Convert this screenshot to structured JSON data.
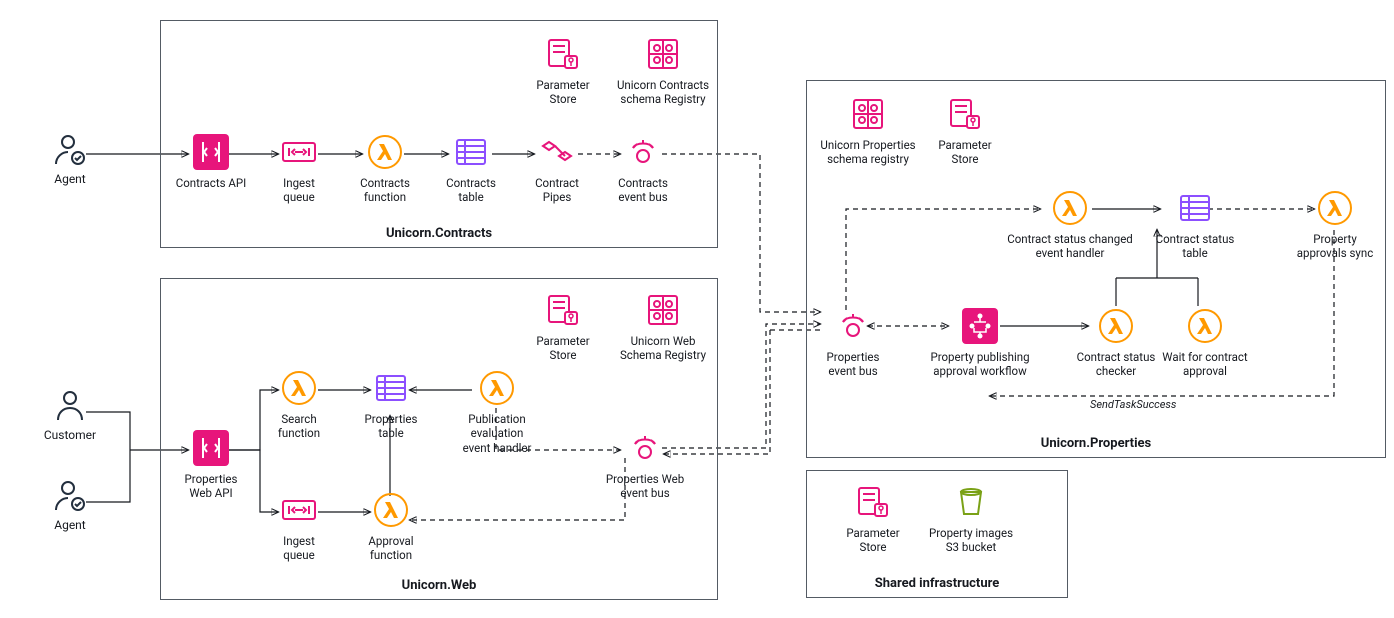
{
  "actors": {
    "agent1": "Agent",
    "customer": "Customer",
    "agent2": "Agent"
  },
  "contracts_box": {
    "title": "Unicorn.Contracts",
    "nodes": {
      "api": "Contracts API",
      "ingest": "Ingest\nqueue",
      "func": "Contracts\nfunction",
      "table": "Contracts\ntable",
      "pipes": "Contract\nPipes",
      "bus": "Contracts\nevent bus",
      "param": "Parameter\nStore",
      "schema": "Unicorn Contracts\nschema Registry"
    }
  },
  "web_box": {
    "title": "Unicorn.Web",
    "nodes": {
      "api": "Properties\nWeb API",
      "search": "Search\nfunction",
      "ingest": "Ingest\nqueue",
      "table": "Properties\ntable",
      "approval": "Approval\nfunction",
      "pubeval": "Publication\nevaluation\nevent handler",
      "bus": "Properties Web\nevent bus",
      "param": "Parameter\nStore",
      "schema": "Unicorn Web\nSchema Registry"
    }
  },
  "props_box": {
    "title": "Unicorn.Properties",
    "nodes": {
      "schema": "Unicorn Properties\nschema registry",
      "param": "Parameter\nStore",
      "bus": "Properties\nevent bus",
      "workflow": "Property publishing\napproval workflow",
      "statushandler": "Contract status changed\nevent handler",
      "statustable": "Contract status\ntable",
      "checker": "Contract status\nchecker",
      "wait": "Wait for contract\napproval",
      "approvalsync": "Property\napprovals sync",
      "sendtask": "SendTaskSuccess"
    }
  },
  "shared_box": {
    "title": "Shared infrastructure",
    "nodes": {
      "param": "Parameter\nStore",
      "s3": "Property images\nS3 bucket"
    }
  }
}
